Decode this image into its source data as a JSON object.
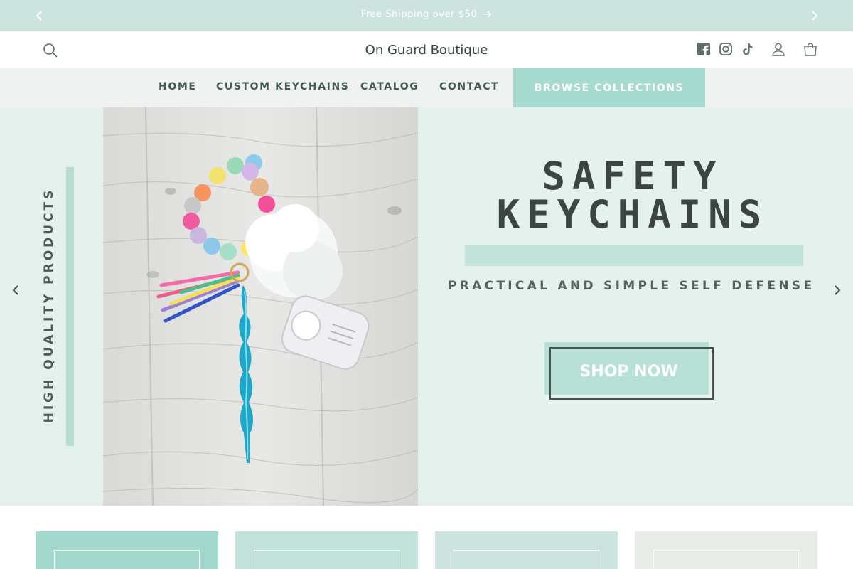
{
  "announcement": {
    "message": "Free Shipping over $50",
    "prev_icon": "chevron-left-icon",
    "next_icon": "chevron-right-icon",
    "arrow_icon": "arrow-right-icon"
  },
  "header": {
    "brand": "On Guard Boutique",
    "icons": [
      "search-icon",
      "facebook-icon",
      "instagram-icon",
      "tiktok-icon",
      "account-icon",
      "cart-icon"
    ]
  },
  "nav": {
    "items": [
      {
        "label": "HOME"
      },
      {
        "label": "CUSTOM KEYCHAINS"
      },
      {
        "label": "CATALOG"
      },
      {
        "label": "CONTACT"
      }
    ],
    "cta": "BROWSE COLLECTIONS"
  },
  "hero": {
    "side_text": "HIGH QUALITY PRODUCTS",
    "title_line1": "SAFETY",
    "title_line2": "KEYCHAINS",
    "subtitle": "PRACTICAL AND SIMPLE SELF DEFENSE",
    "button": "SHOP NOW",
    "prev_icon": "chevron-left-icon",
    "next_icon": "chevron-right-icon"
  },
  "colors": {
    "announcement_bg": "#cde3de",
    "nav_bg": "#eef3f2",
    "cta_bg": "#a7dbd0",
    "hero_bg": "#e4f1ec",
    "accent": "#b7ddd2",
    "card_colors": [
      "#a3d9cd",
      "#c1e3d9",
      "#cde3de",
      "#e8ece9"
    ]
  }
}
